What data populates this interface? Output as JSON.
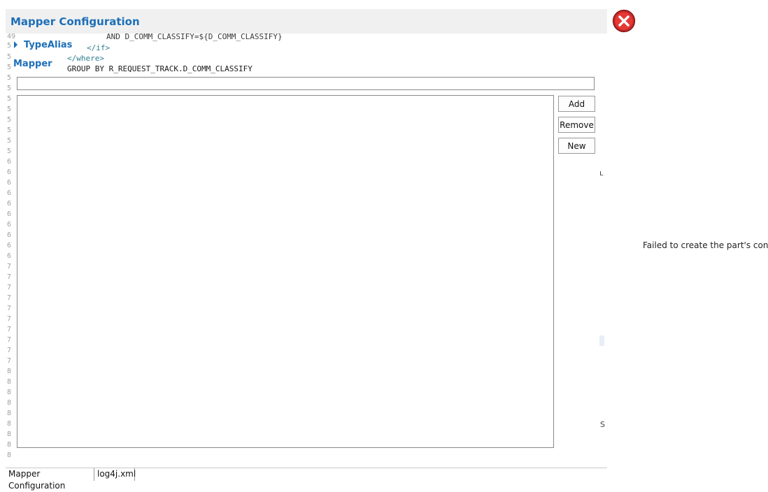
{
  "window": {
    "title": "Mapper Configuration"
  },
  "background_code": {
    "line_top": "AND D_COMM_CLASSIFY=${D_COMM_CLASSIFY}",
    "if_close": "</if>",
    "where_close": "</where>",
    "group_by": "GROUP BY R_REQUEST_TRACK.D_COMM_CLASSIFY"
  },
  "gutter": {
    "numbers": [
      "49",
      "5",
      "5",
      "5",
      "5",
      "5",
      "5",
      "5",
      "5",
      "5",
      "5",
      "5",
      "6",
      "6",
      "6",
      "6",
      "6",
      "6",
      "6",
      "6",
      "6",
      "6",
      "7",
      "7",
      "7",
      "7",
      "7",
      "7",
      "7",
      "7",
      "7",
      "7",
      "8",
      "8",
      "8",
      "8",
      "8",
      "8",
      "8",
      "8",
      "8"
    ]
  },
  "sections": {
    "type_alias": "TypeAlias",
    "mapper": "Mapper"
  },
  "mapper_input": {
    "value": ""
  },
  "buttons": {
    "add": "Add",
    "remove": "Remove",
    "new": "New"
  },
  "edge_fragments": {
    "frag1": "ʟ",
    "frag2": "S"
  },
  "error": {
    "message": "Failed to create the part's controls"
  },
  "tabs": [
    {
      "label": "Mapper Configuration",
      "active": true
    },
    {
      "label": "log4j.xml",
      "active": false
    }
  ],
  "colors": {
    "accent": "#1c6fb8",
    "error_red": "#d32f2f"
  }
}
